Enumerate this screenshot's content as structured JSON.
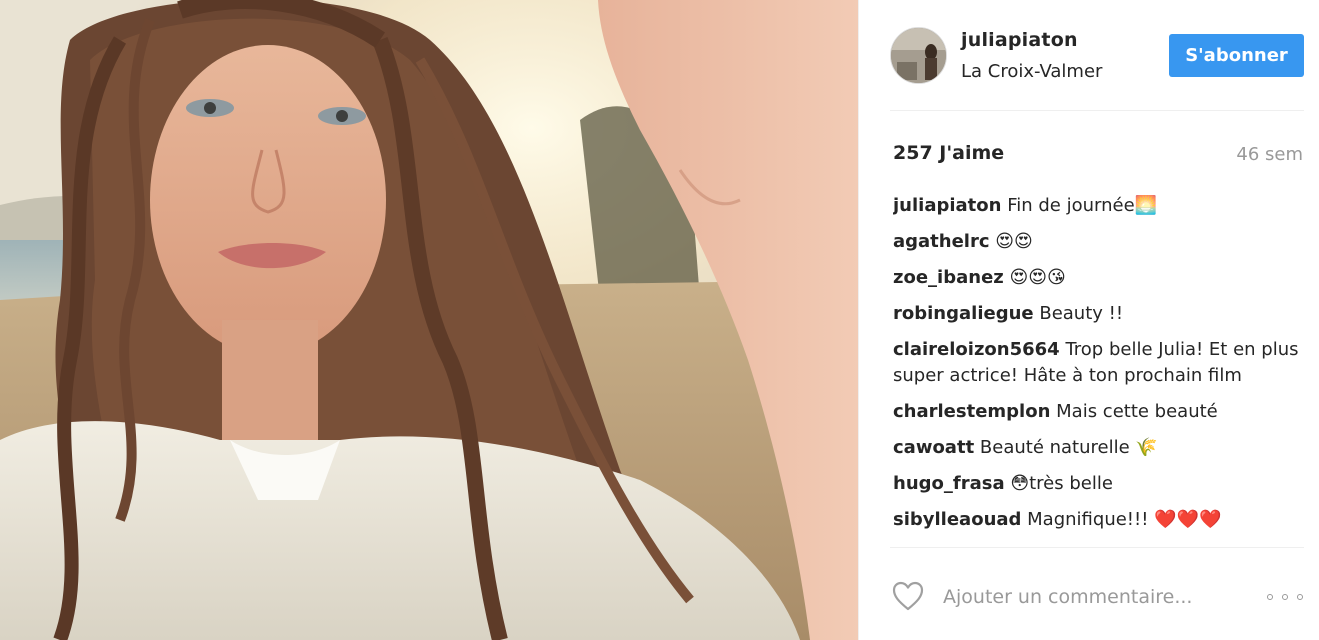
{
  "post": {
    "username": "juliapiaton",
    "location": "La Croix-Valmer",
    "follow_label": "S'abonner",
    "likes": "257 J'aime",
    "age": "46 sem"
  },
  "comments": [
    {
      "user": "juliapiaton",
      "text": "Fin de journée🌅"
    },
    {
      "user": "agathelrc",
      "text": "😍😍"
    },
    {
      "user": "zoe_ibanez",
      "text": "😍😍😘"
    },
    {
      "user": "robingaliegue",
      "text": "Beauty !!"
    },
    {
      "user": "claireloizon5664",
      "text": "Trop belle Julia! Et en plus super actrice! Hâte à ton prochain film"
    },
    {
      "user": "charlestemplon",
      "text": "Mais cette beauté"
    },
    {
      "user": "cawoatt",
      "text": "Beauté naturelle 🌾"
    },
    {
      "user": "hugo_frasa",
      "text": "😳très belle"
    },
    {
      "user": "sibylleaouad",
      "text": "Magnifique!!! ❤️❤️❤️"
    }
  ],
  "footer": {
    "comment_placeholder": "Ajouter un commentaire...",
    "like_icon": "heart-outline-icon",
    "more_icon": "more-options-icon"
  },
  "colors": {
    "follow_button": "#3897f0",
    "muted_text": "#999999"
  }
}
